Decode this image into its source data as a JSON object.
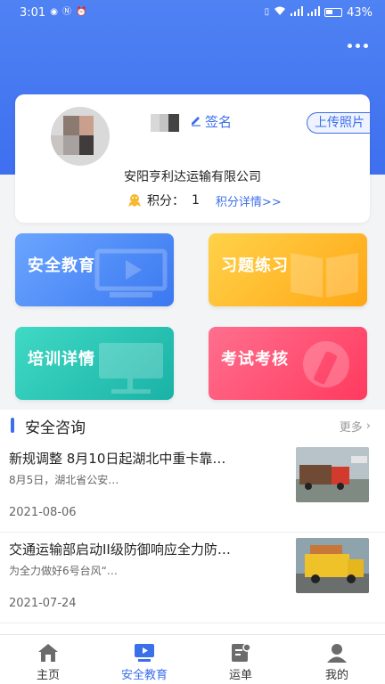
{
  "status_bar": {
    "time": "3:01",
    "battery": "43%",
    "left_icons": [
      "eye-icon",
      "nfc-icon",
      "alarm-icon"
    ],
    "right_icons": [
      "vibrate-icon",
      "wifi-icon",
      "signal-icon",
      "signal-icon",
      "battery-icon"
    ]
  },
  "header": {
    "more_icon": "more-dots-icon",
    "accent_color": "#3e6ff0"
  },
  "profile": {
    "sign_label": "签名",
    "upload_label": "上传照片",
    "company": "安阳亨利达运输有限公司",
    "points_label": "积分：",
    "points_value": "1",
    "points_detail": "积分详情>>"
  },
  "tiles": [
    {
      "label": "安全教育",
      "color": "#4a86f5",
      "icon": "video-board-icon"
    },
    {
      "label": "习题练习",
      "color": "#ffb72a",
      "icon": "open-book-icon"
    },
    {
      "label": "培训详情",
      "color": "#25c2b3",
      "icon": "easel-board-icon"
    },
    {
      "label": "考试考核",
      "color": "#ff4c6f",
      "icon": "exam-pen-icon"
    }
  ],
  "news": {
    "title": "安全咨询",
    "more": "更多",
    "items": [
      {
        "title": "新规调整 8月10日起湖北中重卡靠…",
        "summary": "8月5日，湖北省公安…",
        "date": "2021-08-06"
      },
      {
        "title": "交通运输部启动II级防御响应全力防…",
        "summary": "为全力做好6号台风“…",
        "date": "2021-07-24"
      }
    ]
  },
  "tabbar": {
    "items": [
      {
        "label": "主页",
        "icon": "home-icon",
        "active": false
      },
      {
        "label": "安全教育",
        "icon": "video-board-icon",
        "active": true
      },
      {
        "label": "运单",
        "icon": "waybill-icon",
        "active": false
      },
      {
        "label": "我的",
        "icon": "user-icon",
        "active": false
      }
    ]
  }
}
